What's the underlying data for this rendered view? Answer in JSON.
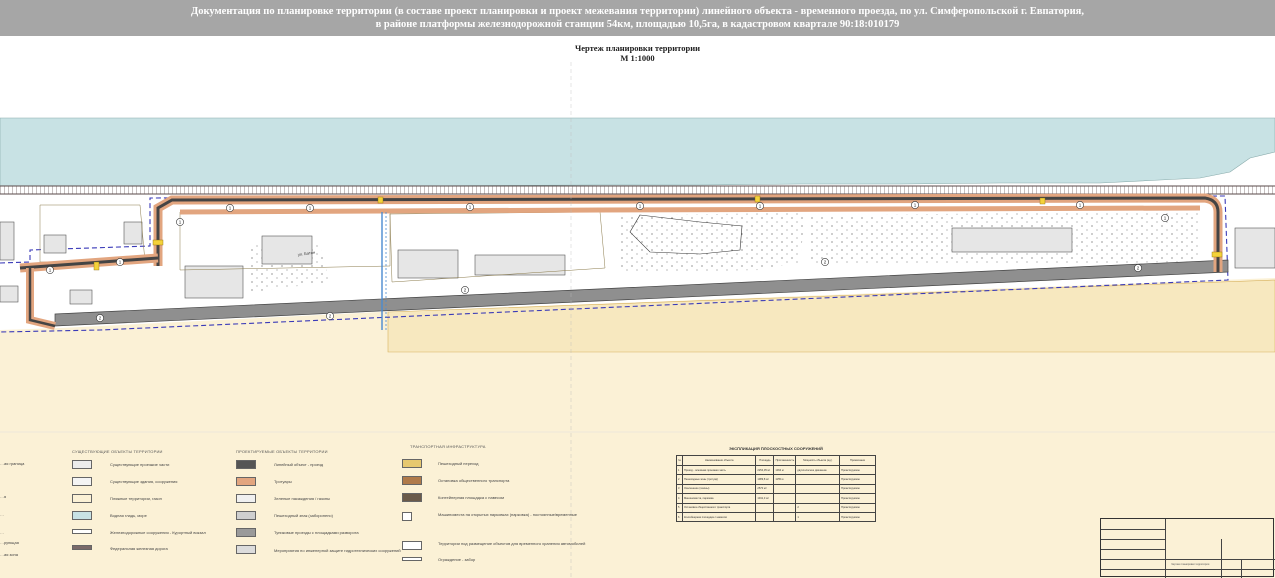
{
  "header": {
    "line1": "Документация по планировке территории (в составе проект планировки и проект межевания территории) линейного объекта - временного проезда, по ул. Симферопольской г. Евпатория,",
    "line2": "в районе платформы железнодорожной станции 54км, площадью 10,5га, в кадастровом квартале 90:18:010179"
  },
  "drawing": {
    "title": "Чертеж планировки территории",
    "scale": "М 1:1000"
  },
  "map_labels": {
    "street": "ул. Батон",
    "road_markers": [
      "2",
      "2",
      "2",
      "2",
      "2",
      "1",
      "1",
      "1",
      "1",
      "1",
      "1",
      "1",
      "1",
      "1",
      "1",
      "1"
    ]
  },
  "colors": {
    "header_bg": "#a6a6a6",
    "sea": "#c8e2e4",
    "beach": "#fbf1d6",
    "road": "#8f8f8f",
    "sidewalk": "#e2a57f",
    "boundary": "#3a3ab8",
    "railway": "#5a4a4a"
  },
  "legend": {
    "left_column": [
      "…ая граница",
      "…я",
      "…",
      "…",
      "…рующая",
      "…ая зона"
    ],
    "existing": {
      "heading": "СУЩЕСТВУЮЩИЕ ОБЪЕКТЫ ТЕРРИТОРИИ",
      "items": [
        "Существующие проезжие части",
        "Существующие здания, сооружения",
        "Пляжные территории, газон",
        "Водная гладь, море",
        "Железнодорожные сооружения - Курортный вокзал",
        "Федеральная железная дорога"
      ]
    },
    "planned": {
      "heading": "ПРОЕКТИРУЕМЫЕ ОБЪЕКТЫ ТЕРРИТОРИИ",
      "items": [
        "Линейный объект - проезд",
        "Тротуары",
        "Зеленые насаждения / газоны",
        "Пешеходный знак (заборонено)",
        "Тупиковые проезды с площадками разворота",
        "Мероприятия по инженерной защите гидротехнических сооружений"
      ]
    },
    "transport": {
      "heading": "ТРАНСПОРТНАЯ ИНФРАСТРУКТУРА",
      "items": [
        "Пешеходный переход",
        "Остановка общественного транспорта",
        "Контейнерная площадка с навесом",
        "Машиноместа на открытых парковках (парковка) - постоянные/временные",
        "Территории под размещение объектов для временного хранения автомобилей",
        "Ограждение - забор"
      ]
    }
  },
  "explication": {
    "title": "ЭКСПЛИКАЦИЯ ПЛОСКОСТНЫХ СООРУЖЕНИЙ",
    "headers": [
      "№",
      "Наименование объекта",
      "Площадь",
      "Протяженность",
      "Мощность объекта (ед.)",
      "Примечание"
    ],
    "rows": [
      [
        "1",
        "Проезд - основная проезжая часть",
        "2254,05 м²",
        "1394 м",
        "двухполосное движение",
        "Проектируемое"
      ],
      [
        "2",
        "Пешеходные зоны (тротуар)",
        "1089,8 м²",
        "1155 м",
        "",
        "Проектируемое"
      ],
      [
        "3",
        "Озеленение (газоны)",
        "2570 м²",
        "",
        "",
        "Проектируемое"
      ],
      [
        "4",
        "Машиноместа, парковка",
        "1041,3 м²",
        "",
        "",
        "Проектируемое"
      ],
      [
        "5",
        "Остановка общественного транспорта",
        "",
        "",
        "2",
        "Проектируемое"
      ],
      [
        "6",
        "Контейнерная площадка с навесом",
        "",
        "",
        "1",
        "Проектируемое"
      ]
    ]
  },
  "stamp": {
    "label": "Чертеж планировки территории"
  }
}
